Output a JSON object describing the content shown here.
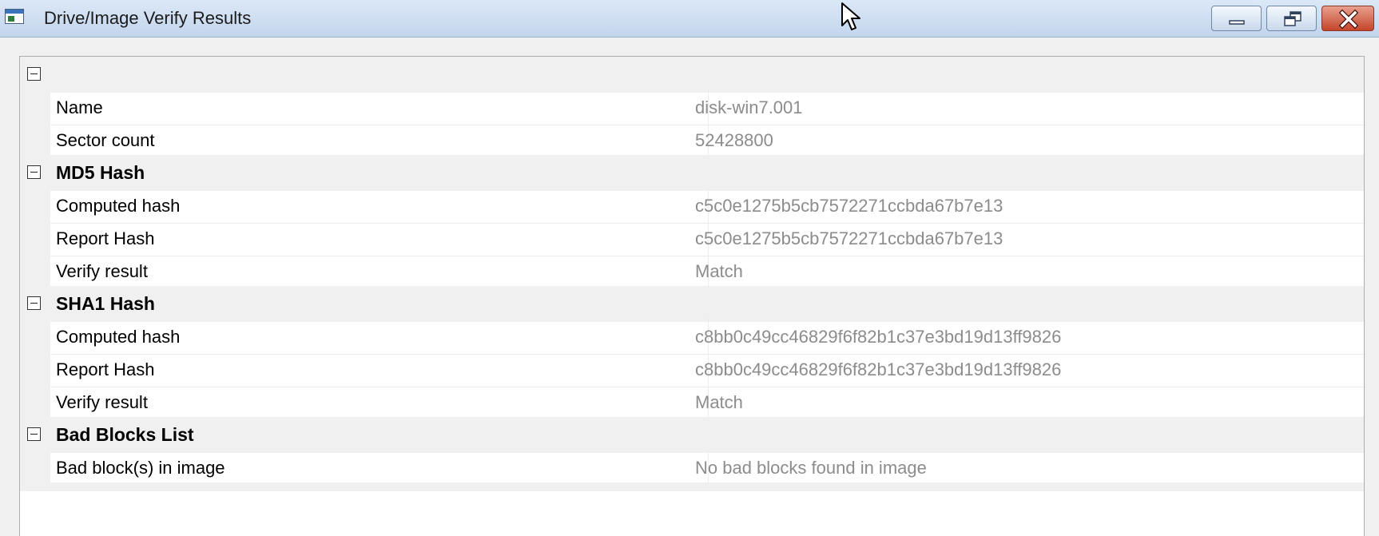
{
  "window": {
    "title": "Drive/Image Verify Results",
    "icon": "window-app-icon",
    "controls": [
      "minimize-icon",
      "restore-icon",
      "close-icon"
    ]
  },
  "grid": {
    "categories": [
      {
        "label": "",
        "items": [
          {
            "name": "Name",
            "value": "disk-win7.001"
          },
          {
            "name": "Sector count",
            "value": "52428800"
          }
        ]
      },
      {
        "label": "MD5 Hash",
        "items": [
          {
            "name": "Computed hash",
            "value": "c5c0e1275b5cb7572271ccbda67b7e13"
          },
          {
            "name": "Report Hash",
            "value": "c5c0e1275b5cb7572271ccbda67b7e13"
          },
          {
            "name": "Verify result",
            "value": "Match"
          }
        ]
      },
      {
        "label": "SHA1 Hash",
        "items": [
          {
            "name": "Computed hash",
            "value": "c8bb0c49cc46829f6f82b1c37e3bd19d13ff9826"
          },
          {
            "name": "Report Hash",
            "value": "c8bb0c49cc46829f6f82b1c37e3bd19d13ff9826"
          },
          {
            "name": "Verify result",
            "value": "Match"
          }
        ]
      },
      {
        "label": "Bad Blocks List",
        "items": [
          {
            "name": "Bad block(s) in image",
            "value": "No bad blocks found in image"
          }
        ]
      }
    ]
  }
}
